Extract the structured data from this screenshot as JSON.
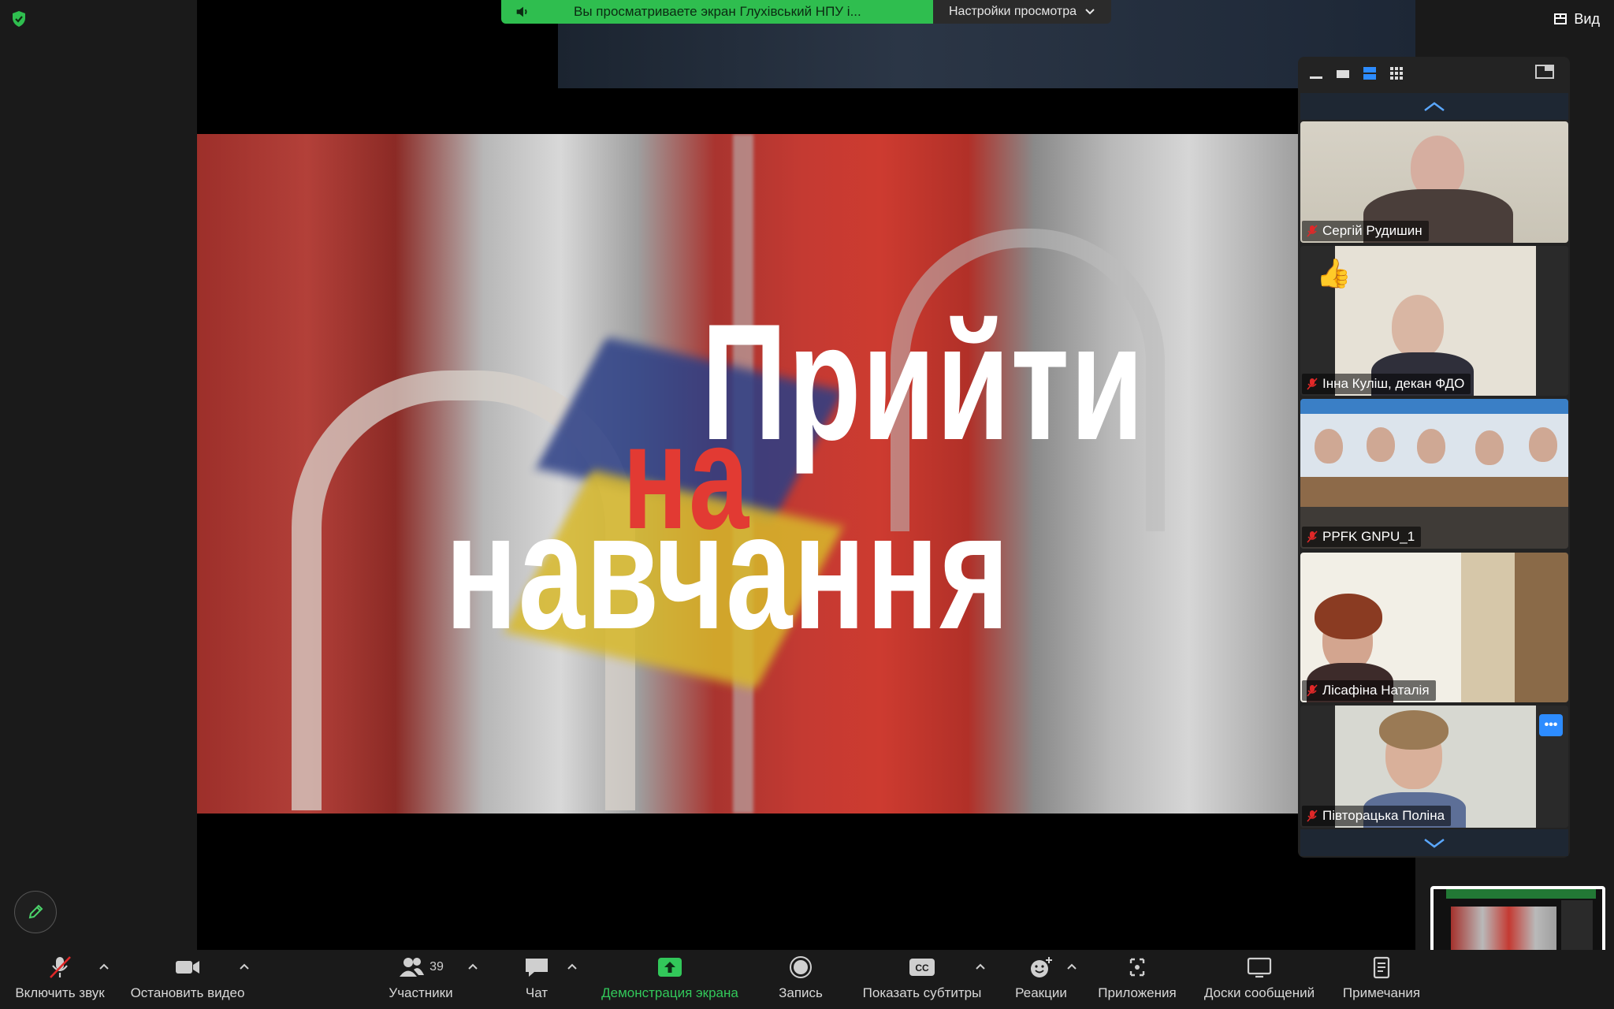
{
  "share_banner": {
    "text": "Вы просматриваете экран Глухівський НПУ і...",
    "view_settings": "Настройки просмотра"
  },
  "view_button": {
    "label": "Вид"
  },
  "video": {
    "line1": "Прийти",
    "line2": "на",
    "line3": "навчання"
  },
  "participants_tiles": [
    {
      "name": "Сергій Рудишин",
      "muted": true
    },
    {
      "name": "Інна Куліш, декан ФДО",
      "muted": true,
      "reaction": "👍"
    },
    {
      "name": "PPFK GNPU_1",
      "muted": true
    },
    {
      "name": "Лісафіна Наталія",
      "muted": true
    },
    {
      "name": "Півторацька Поліна",
      "muted": true
    }
  ],
  "toolbar": {
    "unmute": "Включить звук",
    "stop_video": "Остановить видео",
    "participants": "Участники",
    "participants_count": "39",
    "chat": "Чат",
    "share_screen": "Демонстрация экрана",
    "record": "Запись",
    "captions": "Показать субтитры",
    "reactions": "Реакции",
    "apps": "Приложения",
    "whiteboards": "Доски сообщений",
    "notes": "Примечания"
  },
  "icons": {
    "shield": "shield-check-icon",
    "speaker": "speaker-icon",
    "chevron": "chevron-down-icon",
    "pencil": "pencil-icon"
  },
  "colors": {
    "banner_green": "#2fbe4f",
    "accent_blue": "#2d8cff",
    "muted_red": "#e02828",
    "share_green": "#32c85a"
  }
}
